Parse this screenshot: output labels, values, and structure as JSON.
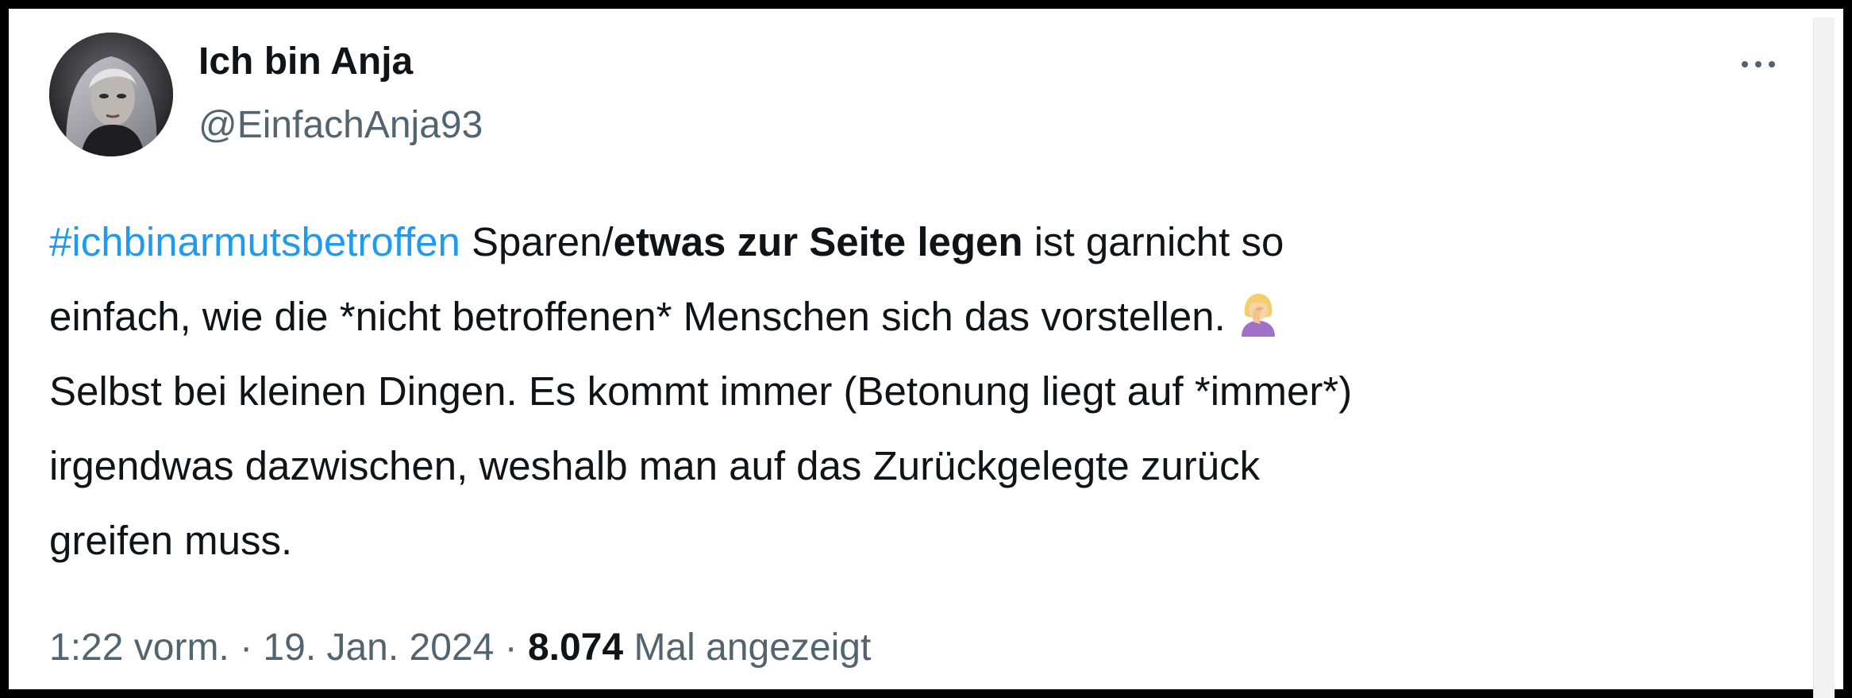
{
  "author": {
    "display_name": "Ich bin Anja",
    "handle": "@EinfachAnja93",
    "avatar_icon": "profile-avatar"
  },
  "more_icon": "more-horizontal-icon",
  "tweet": {
    "line1": {
      "hashtag": "#ichbinarmutsbetroffen",
      "text_a": " Sparen/",
      "bold": "etwas zur Seite legen",
      "text_b": " ist garnicht so"
    },
    "line2": {
      "text": "einfach, wie die *nicht betroffenen* Menschen sich das vorstellen.",
      "emoji": "woman-facepalming-emoji"
    },
    "line3": "Selbst bei kleinen Dingen. Es kommt immer (Betonung liegt auf *immer*)",
    "line4": "irgendwas dazwischen, weshalb man auf das Zurückgelegte zurück",
    "line5": "greifen muss."
  },
  "meta": {
    "time": "1:22 vorm.",
    "sep1": " · ",
    "date": "19. Jan. 2024",
    "sep2": " · ",
    "views_count": "8.074",
    "views_label": " Mal angezeigt"
  },
  "colors": {
    "text": "#0f1419",
    "secondary": "#536471",
    "link": "#1d9bf0"
  }
}
